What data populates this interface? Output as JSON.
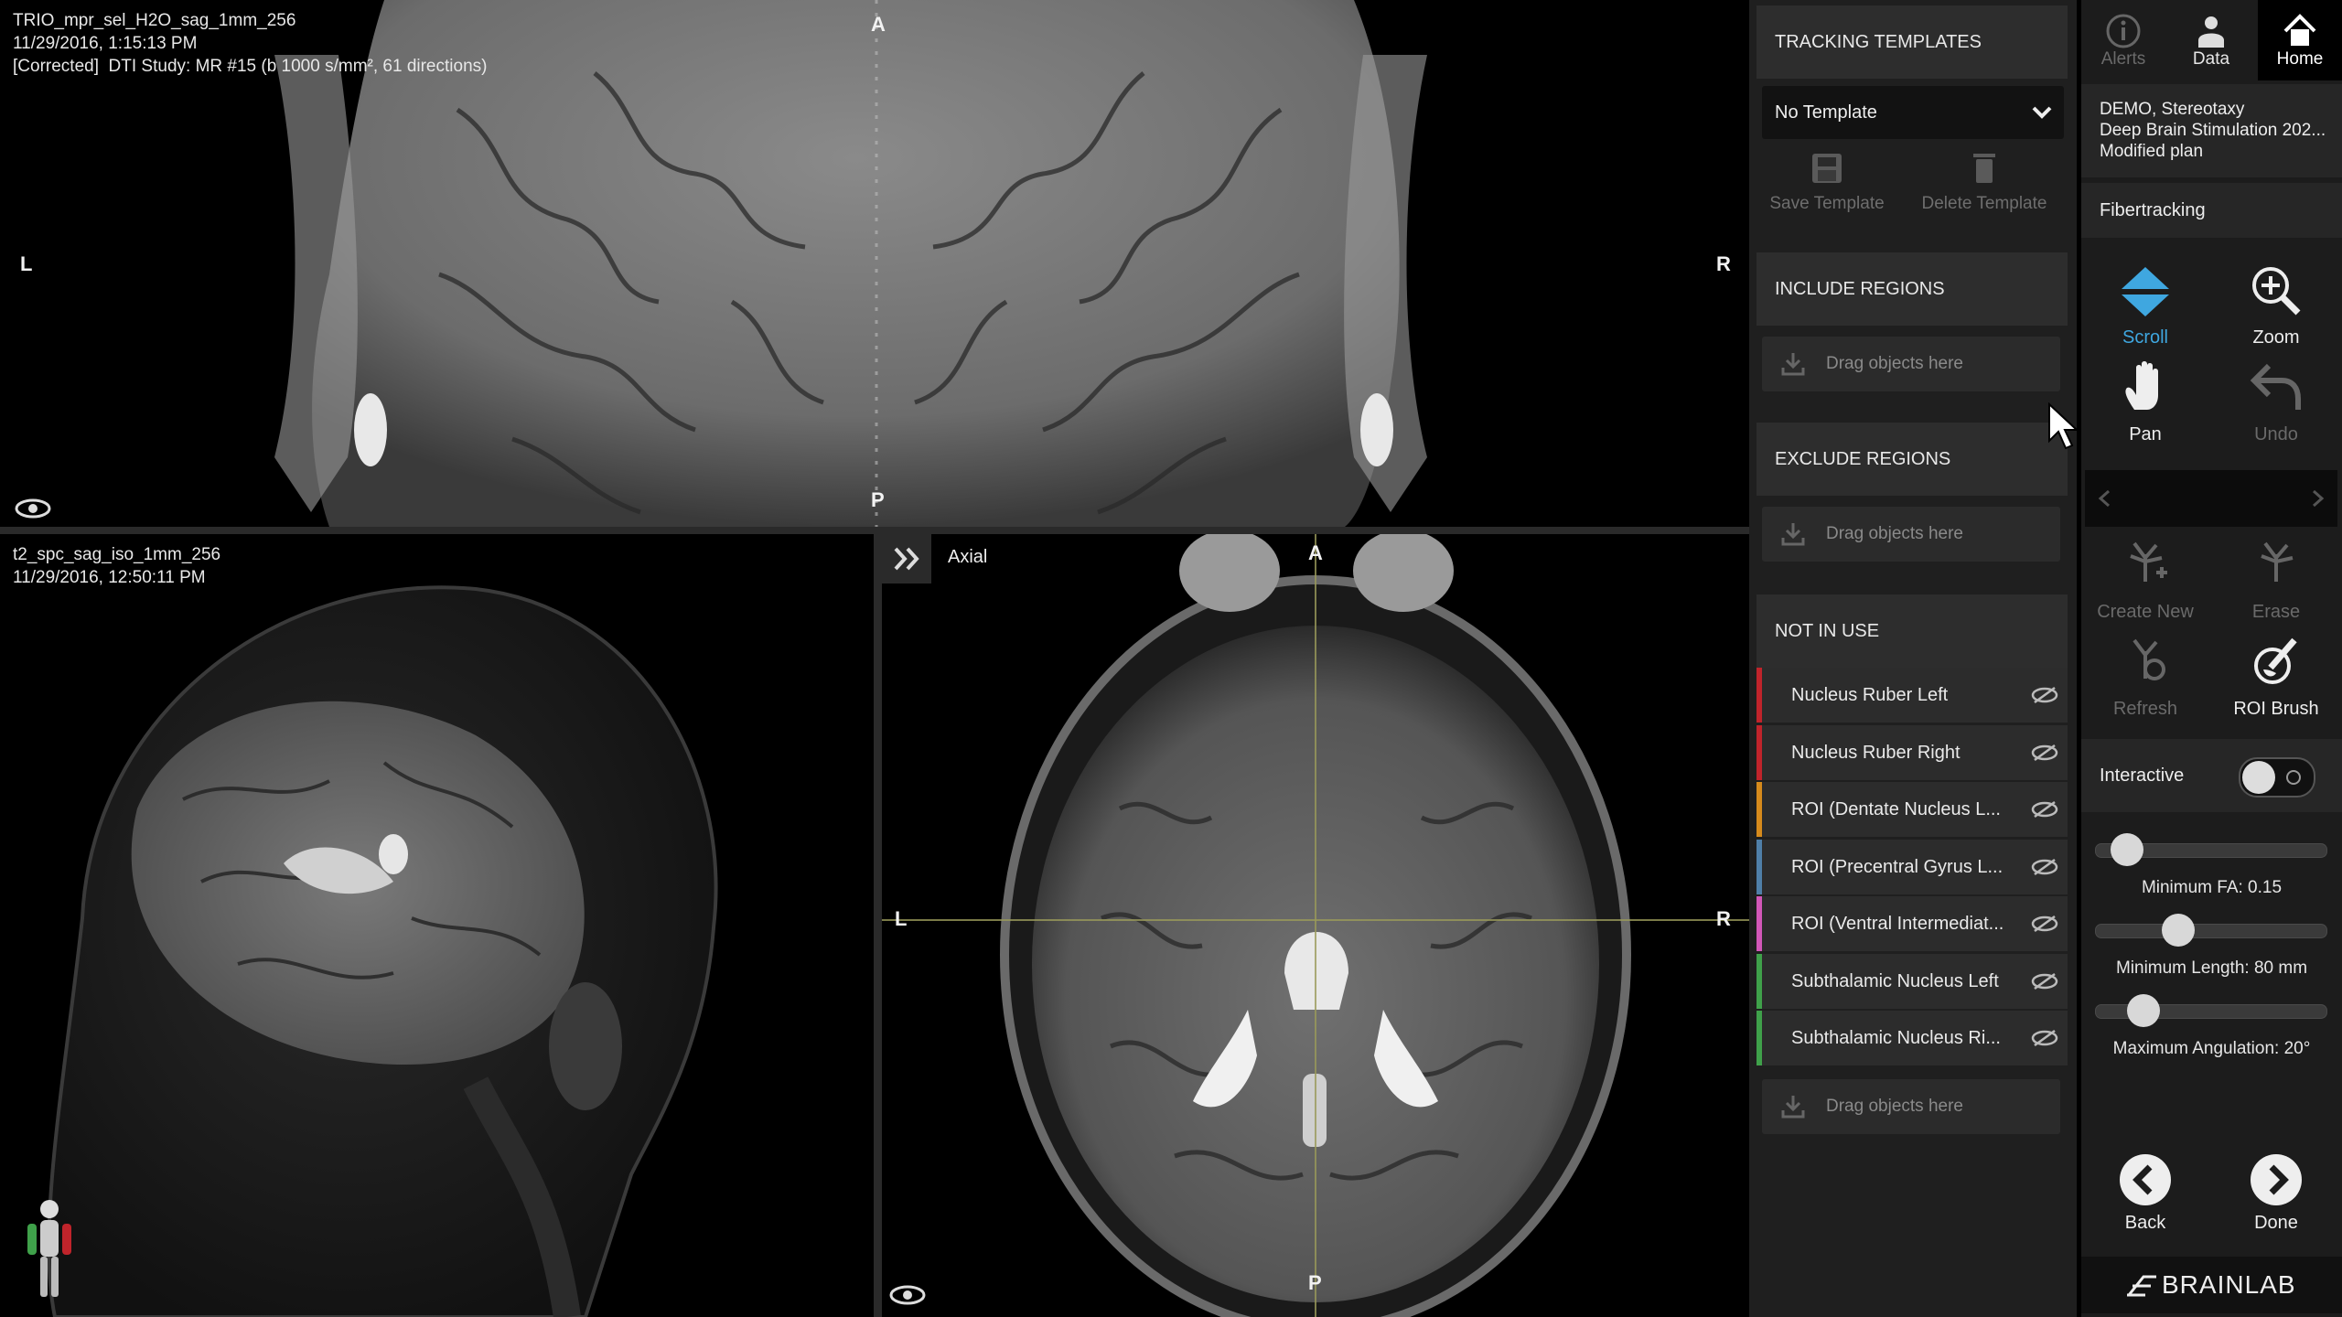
{
  "viewports": {
    "top": {
      "info_line1": "TRIO_mpr_sel_H2O_sag_1mm_256",
      "info_line2": "11/29/2016, 1:15:13 PM",
      "info_line3": "[Corrected]  DTI Study: MR #15 (b 1000 s/mm², 61 directions)",
      "orient_top": "A",
      "orient_bottom": "P",
      "orient_left": "L",
      "orient_right": "R"
    },
    "bottom_left": {
      "info_line1": "t2_spc_sag_iso_1mm_256",
      "info_line2": "11/29/2016, 12:50:11 PM"
    },
    "bottom_right": {
      "label": "Axial",
      "orient_top": "A",
      "orient_bottom": "P",
      "orient_left": "L",
      "orient_right": "R"
    }
  },
  "tracking_templates": {
    "title": "TRACKING TEMPLATES",
    "selected": "No Template",
    "save_label": "Save Template",
    "delete_label": "Delete Template"
  },
  "include_regions": {
    "title": "INCLUDE REGIONS",
    "drop_hint": "Drag objects here"
  },
  "exclude_regions": {
    "title": "EXCLUDE REGIONS",
    "drop_hint": "Drag objects here"
  },
  "not_in_use": {
    "title": "NOT IN USE",
    "drop_hint": "Drag objects here",
    "items": [
      {
        "label": "Nucleus Ruber Left",
        "color": "#c0242b"
      },
      {
        "label": "Nucleus Ruber Right",
        "color": "#c0242b"
      },
      {
        "label": "ROI (Dentate Nucleus L...",
        "color": "#d68a1c"
      },
      {
        "label": "ROI (Precentral Gyrus L...",
        "color": "#4f7fa8"
      },
      {
        "label": "ROI (Ventral Intermediat...",
        "color": "#d257b8"
      },
      {
        "label": "Subthalamic Nucleus Left",
        "color": "#3fa14a"
      },
      {
        "label": "Subthalamic Nucleus Ri...",
        "color": "#3fa14a"
      }
    ]
  },
  "nav": {
    "alerts": "Alerts",
    "data": "Data",
    "home": "Home"
  },
  "patient": {
    "line1": "DEMO, Stereotaxy",
    "line2": "Deep Brain Stimulation 202...",
    "line3": "Modified plan"
  },
  "module_title": "Fibertracking",
  "tools": {
    "scroll": "Scroll",
    "zoom": "Zoom",
    "pan": "Pan",
    "undo": "Undo",
    "create_new": "Create New",
    "erase": "Erase",
    "refresh": "Refresh",
    "roi_brush": "ROI Brush"
  },
  "interactive_label": "Interactive",
  "sliders": {
    "min_fa": {
      "label": "Minimum FA: 0.15",
      "value": 0.15
    },
    "min_length": {
      "label": "Minimum Length: 80 mm",
      "value": 80
    },
    "max_angulation": {
      "label": "Maximum Angulation: 20°",
      "value": 20
    }
  },
  "footer": {
    "back": "Back",
    "done": "Done",
    "brand": "BRAINLAB"
  },
  "colors": {
    "accent_blue": "#3fa7e0",
    "panel_bg": "#1f1f1f",
    "header_bg": "#2d2d2d"
  }
}
